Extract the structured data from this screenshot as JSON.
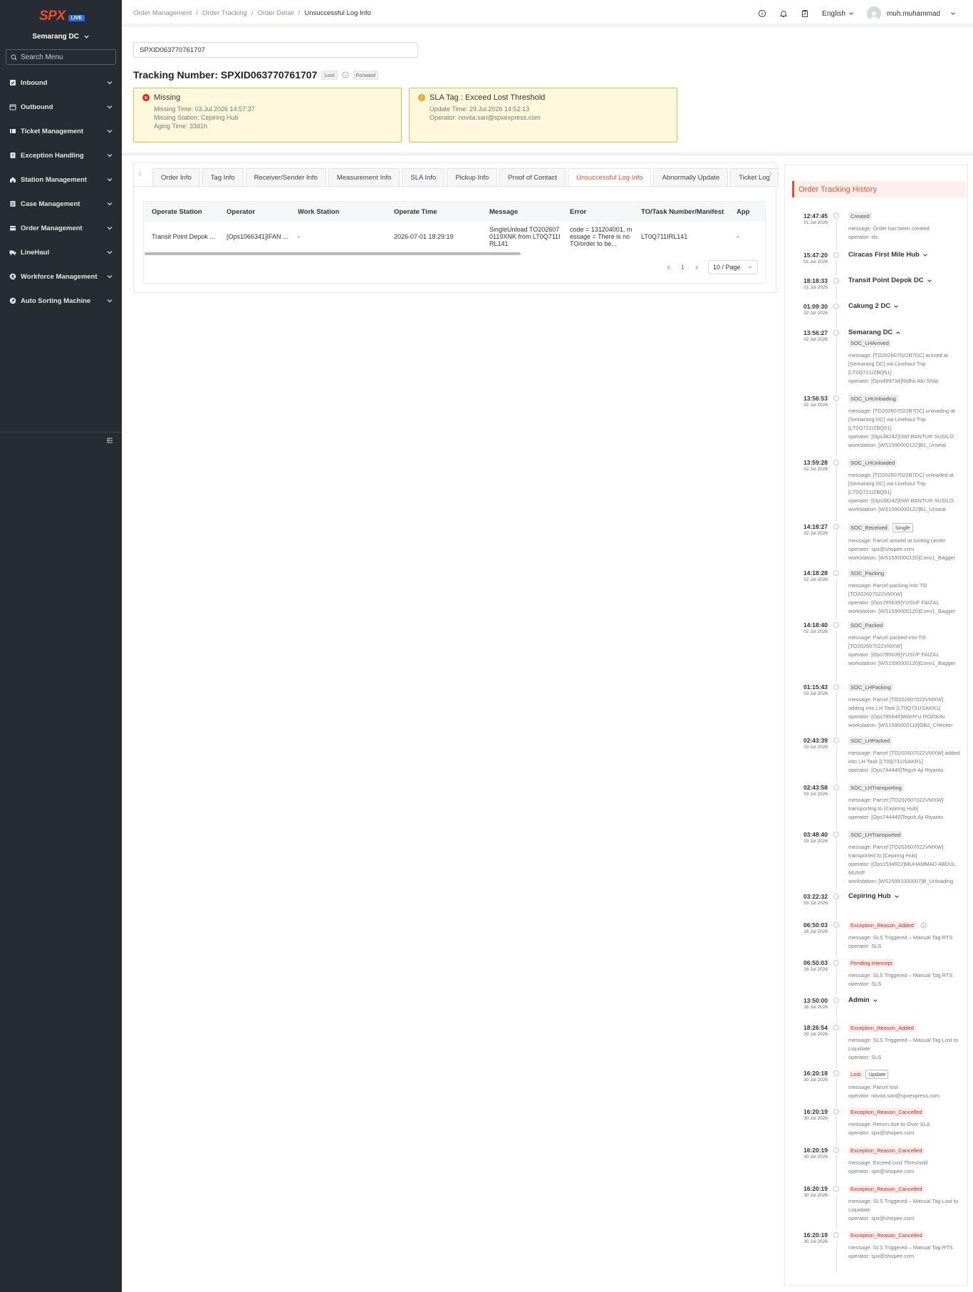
{
  "sidebar": {
    "logo_text": "SPX",
    "logo_badge": "LIVE",
    "dc_name": "Semarang DC",
    "search_placeholder": "Search Menu",
    "items": [
      {
        "label": "Inbound",
        "icon": "inbound-icon"
      },
      {
        "label": "Outbound",
        "icon": "outbound-icon"
      },
      {
        "label": "Ticket Management",
        "icon": "ticket-icon"
      },
      {
        "label": "Exception Handling",
        "icon": "exception-icon"
      },
      {
        "label": "Station Management",
        "icon": "home-icon"
      },
      {
        "label": "Case Management",
        "icon": "case-icon"
      },
      {
        "label": "Order Management",
        "icon": "order-icon"
      },
      {
        "label": "LineHaul",
        "icon": "truck-icon"
      },
      {
        "label": "Workforce Management",
        "icon": "workforce-icon"
      },
      {
        "label": "Auto Sorting Machine",
        "icon": "sorting-icon"
      }
    ]
  },
  "header": {
    "breadcrumbs": [
      "Order Management",
      "Order Tracking",
      "Order Detail",
      "Unsuccessful Log Info"
    ],
    "language": "English",
    "username": "muh.muhammad"
  },
  "tracking": {
    "input_value": "SPXID063770761707",
    "title": "Tracking Number: SPXID063770761707",
    "tag_lost": "Lost",
    "tag_forward": "Forward"
  },
  "cards": {
    "missing": {
      "title": "Missing",
      "lines": [
        "Missing Time: 03.Jul.2026 14:57:37",
        "Missing Station: Cepiring Hub",
        "Aging Time: 33d1h"
      ]
    },
    "sla": {
      "title": "SLA Tag : Exceed Lost Threshold",
      "lines": [
        "Update Time: 29.Jul.2026 14:52:13",
        "Operator: novita.sari@spxexpress.com"
      ]
    }
  },
  "tabs": [
    "Order Info",
    "Tag Info",
    "Receiver/Sender Info",
    "Measurement Info",
    "SLA Info",
    "Pickup Info",
    "Proof of Contact",
    "Unsuccessful Log Info",
    "Abnormally Update",
    "Ticket Log"
  ],
  "active_tab": "Unsuccessful Log Info",
  "table": {
    "columns": [
      "Operate Station",
      "Operator",
      "Work Station",
      "Operate Time",
      "Message",
      "Error",
      "TO/Task Number/Manifest",
      "App"
    ],
    "rows": [
      [
        "Transit Point Depok ...",
        "[Ops1066341]IFAN ...",
        "-",
        "2026-07-01 18:29:19",
        "SingleUnload TO2026070119XNK from LT0Q711IRL141",
        "code = 131204001, message = There is no TO/order to be...",
        "LT0Q711IRL141",
        "-"
      ]
    ]
  },
  "pagination": {
    "current": "1",
    "page_size": "10 / Page"
  },
  "history": {
    "title": "Order Tracking History",
    "events": [
      {
        "time": "12:47:45",
        "date": "01 Jul 2026",
        "badge": "Created",
        "badge_style": "gray",
        "lines": [
          "message: Order has been created",
          "operator: sls"
        ]
      },
      {
        "time": "15:47:20",
        "date": "01 Jul 2026",
        "station": "Ciracas First Mile Hub",
        "chevron": "down"
      },
      {
        "time": "18:18:33",
        "date": "01 Jul 2026",
        "station": "Transit Point Depok DC",
        "chevron": "down"
      },
      {
        "time": "01:09:30",
        "date": "02 Jul 2026",
        "station": "Cakung 2 DC",
        "chevron": "down"
      },
      {
        "time": "13:56:27",
        "date": "02 Jul 2026",
        "station": "Semarang DC",
        "chevron": "up",
        "badge": "SOC_LHArrived",
        "badge_style": "gray",
        "lines": [
          "message: [TO202607022B7DC] arrived at",
          "[Semarang DC] via Linehaul Trip",
          "[LT0Q721IZBQ51]",
          "operator: [Ops499734]Ridho Abi Shila"
        ]
      },
      {
        "time": "13:56:53",
        "date": "02 Jul 2026",
        "badge": "SOC_LHUnloading",
        "badge_style": "gray",
        "lines": [
          "message: [TO202607022B7DC] unloading at",
          "[Semarang DC] via Linehaul Trip",
          "[LT0Q721IZBQ51]",
          "operator: [Ops38242]DWI BANTUR SUSILO",
          "workstation: [WS1590000122]B1_Unseal"
        ]
      },
      {
        "time": "13:59:28",
        "date": "02 Jul 2026",
        "badge": "SOC_LHUnloaded",
        "badge_style": "gray",
        "lines": [
          "message: [TO202607022B7DC] unloaded at",
          "[Semarang DC] via Linehaul Trip",
          "[LT0Q721IZBQ51]",
          "operator: [Ops38242]DWI BANTUR SUSILO",
          "workstation: [WS1590000122]B1_Unseal"
        ]
      },
      {
        "time": "14:18:27",
        "date": "02 Jul 2026",
        "badge": "SOC_Received",
        "badge_style": "gray",
        "badge2": "Single",
        "lines": [
          "message: Parcel arrived at sorting center",
          "operator: spx@shopee.com",
          "workstation: [WS1590000120]Conv1_Bagger"
        ]
      },
      {
        "time": "14:18:28",
        "date": "02 Jul 2026",
        "badge": "SOC_Packing",
        "badge_style": "gray",
        "lines": [
          "message: Parcel packing into TO",
          "[TO202607022VMXW]",
          "operator: [Ops785639]YUSUF FAIZAL",
          "workstation: [WS1590000120]Conv1_Bagger"
        ]
      },
      {
        "time": "14:18:40",
        "date": "02 Jul 2026",
        "badge": "SOC_Packed",
        "badge_style": "gray",
        "lines": [
          "message: Parcel packed into TO",
          "[TO202607022VMXW]",
          "operator: [Ops785639]YUSUF FAIZAL",
          "workstation: [WS1590000120]Conv1_Bagger"
        ]
      },
      {
        "time": "01:15:43",
        "date": "03 Jul 2026",
        "badge": "SOC_LHPacking",
        "badge_style": "gray",
        "lines": [
          "message: Parcel [TO202607022VMXW]",
          "adding into LH Task [LT0Q731ISAKR1]",
          "operator: [Ops785649]WAHYU ROZIKIN",
          "workstation: [WS1590000118]OB2_Checker"
        ]
      },
      {
        "time": "02:43:39",
        "date": "03 Jul 2026",
        "badge": "SOC_LHPacked",
        "badge_style": "gray",
        "lines": [
          "message: Parcel [TO202607022VMXW] added",
          "into LH Task [LT0Q731ISAKR1]",
          "operator: [Ops744449]Teguh Aji Riyanto"
        ]
      },
      {
        "time": "02:43:58",
        "date": "03 Jul 2026",
        "badge": "SOC_LHTransporting",
        "badge_style": "gray",
        "lines": [
          "message: Parcel [TO202607022VMXW]",
          "transporting to [Cepiring Hub]",
          "operator: [Ops744449]Teguh Aji Riyanto"
        ]
      },
      {
        "time": "03:48:40",
        "date": "03 Jul 2026",
        "badge": "SOC_LHTransported",
        "badge_style": "gray",
        "lines": [
          "message: Parcel [TO202607022VMXW]",
          "transported to [Cepiring Hub]",
          "operator: [Ops1534922]MUHAMMAD ABDUL",
          "MUNIF",
          "workstation: [WS25991000007]B_Unloading"
        ]
      },
      {
        "time": "03:22:32",
        "date": "03 Jul 2026",
        "station": "Cepiring Hub",
        "chevron": "down"
      },
      {
        "time": "06:50:03",
        "date": "16 Jul 2026",
        "badge": "Exception_Reason_Added",
        "badge_style": "red",
        "help": true,
        "lines": [
          "message: SLS Triggered – Manual Tag RTS",
          "operator: SLS"
        ]
      },
      {
        "time": "06:50:03",
        "date": "16 Jul 2026",
        "badge": "Pending Intercept",
        "badge_style": "red",
        "lines": [
          "message: SLS Triggered – Manual Tag RTS",
          "operator: SLS"
        ]
      },
      {
        "time": "13:50:00",
        "date": "16 Jul 2026",
        "station": "Admin",
        "chevron": "down"
      },
      {
        "time": "18:26:54",
        "date": "29 Jul 2026",
        "badge": "Exception_Reason_Added",
        "badge_style": "red",
        "lines": [
          "message: SLS Triggered – Manual Tag Lost to",
          "Liquidate",
          "operator: SLS"
        ]
      },
      {
        "time": "16:20:18",
        "date": "30 Jul 2026",
        "badge": "Lost",
        "badge_style": "red",
        "badge2": "Update",
        "lines": [
          "message: Parcel lost",
          "operator: novita.sari@spxexpress.com"
        ]
      },
      {
        "time": "16:20:19",
        "date": "30 Jul 2026",
        "badge": "Exception_Reason_Cancelled",
        "badge_style": "red",
        "lines": [
          "message: Return due to Over SLA",
          "operator: spx@shopee.com"
        ]
      },
      {
        "time": "16:20:19",
        "date": "30 Jul 2026",
        "badge": "Exception_Reason_Cancelled",
        "badge_style": "red",
        "lines": [
          "message: Exceed Lost Threshold",
          "operator: spx@shopee.com"
        ]
      },
      {
        "time": "16:20:19",
        "date": "30 Jul 2026",
        "badge": "Exception_Reason_Cancelled",
        "badge_style": "red",
        "lines": [
          "message: SLS Triggered – Manual Tag Lost to",
          "Liquidate",
          "operator: spx@shopee.com"
        ]
      },
      {
        "time": "16:20:19",
        "date": "30 Jul 2026",
        "badge": "Exception_Reason_Cancelled",
        "badge_style": "red",
        "lines": [
          "message: SLS Triggered – Manual Tag RTS",
          "operator: spx@shopee.com"
        ]
      }
    ]
  },
  "colors": {
    "brand": "#ee4d2d",
    "sidebar_bg": "#272b33",
    "live_badge": "#2b6de5",
    "warn_card_bg": "#fff8dc",
    "warn_card_border": "#e8b84a",
    "missing_icon": "#e0271b",
    "sla_icon": "#f5a623"
  }
}
